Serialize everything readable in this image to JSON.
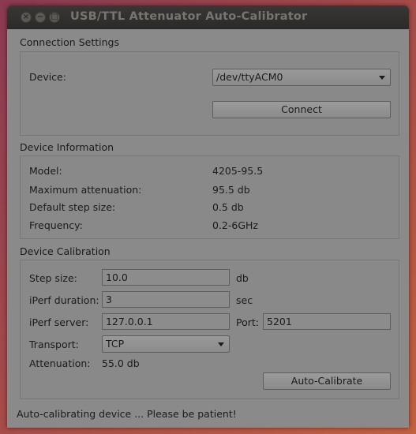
{
  "window": {
    "title": "USB/TTL Attenuator Auto-Calibrator",
    "close_glyph": "×",
    "minimize_glyph": "−",
    "maximize_glyph": "□"
  },
  "connection": {
    "title": "Connection Settings",
    "device_label": "Device:",
    "device_value": "/dev/ttyACM0",
    "connect_label": "Connect"
  },
  "info": {
    "title": "Device Information",
    "model_label": "Model:",
    "model_value": "4205-95.5",
    "max_atten_label": "Maximum attenuation:",
    "max_atten_value": "95.5 db",
    "step_label": "Default step size:",
    "step_value": "0.5 db",
    "freq_label": "Frequency:",
    "freq_value": "0.2-6GHz"
  },
  "calibration": {
    "title": "Device Calibration",
    "step_label": "Step size:",
    "step_value": "10.0",
    "step_unit": "db",
    "duration_label": "iPerf duration:",
    "duration_value": "3",
    "duration_unit": "sec",
    "server_label": "iPerf server:",
    "server_value": "127.0.0.1",
    "port_label": "Port:",
    "port_value": "5201",
    "transport_label": "Transport:",
    "transport_value": "TCP",
    "attenuation_label": "Attenuation:",
    "attenuation_value": "55.0 db",
    "autocal_label": "Auto-Calibrate"
  },
  "status": {
    "text": "Auto-calibrating device ... Please be patient!"
  }
}
